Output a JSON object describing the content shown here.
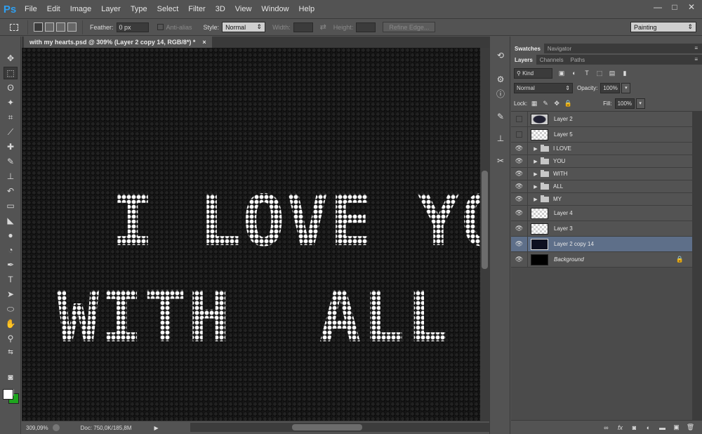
{
  "app": {
    "logo": "Ps"
  },
  "menu": [
    "File",
    "Edit",
    "Image",
    "Layer",
    "Type",
    "Select",
    "Filter",
    "3D",
    "View",
    "Window",
    "Help"
  ],
  "window_controls": {
    "minimize": "—",
    "maximize": "□",
    "close": "✕"
  },
  "options": {
    "feather_label": "Feather:",
    "feather_value": "0 px",
    "antialias_label": "Anti-alias",
    "style_label": "Style:",
    "style_value": "Normal",
    "width_label": "Width:",
    "height_label": "Height:",
    "refine_label": "Refine Edge...",
    "workspace": "Painting"
  },
  "document": {
    "tab_title": "with my hearts.psd @ 309% (Layer 2 copy 14, RGB/8*) *",
    "close": "×",
    "line1": "I LOVE YO",
    "line2": "WITH  ALL"
  },
  "status": {
    "zoom": "309,09%",
    "doc": "Doc: 750,0K/185,8M"
  },
  "panels": {
    "top_tabs": [
      "Swatches",
      "Navigator"
    ],
    "layer_tabs": [
      "Layers",
      "Channels",
      "Paths"
    ],
    "kind_label": "Kind",
    "blend_mode": "Normal",
    "opacity_label": "Opacity:",
    "opacity_value": "100%",
    "lock_label": "Lock:",
    "fill_label": "Fill:",
    "fill_value": "100%"
  },
  "layers": [
    {
      "name": "Layer 2",
      "type": "layer",
      "visible": false,
      "thumb": "blob"
    },
    {
      "name": "Layer 5",
      "type": "layer",
      "visible": false,
      "thumb": "trans"
    },
    {
      "name": "I LOVE",
      "type": "group",
      "visible": true
    },
    {
      "name": "YOU",
      "type": "group",
      "visible": true
    },
    {
      "name": "WITH",
      "type": "group",
      "visible": true
    },
    {
      "name": "ALL",
      "type": "group",
      "visible": true
    },
    {
      "name": "MY",
      "type": "group",
      "visible": true
    },
    {
      "name": "Layer 4",
      "type": "layer",
      "visible": true,
      "thumb": "trans"
    },
    {
      "name": "Layer 3",
      "type": "layer",
      "visible": true,
      "thumb": "trans"
    },
    {
      "name": "Layer 2 copy 14",
      "type": "layer",
      "visible": true,
      "thumb": "navy",
      "selected": true
    },
    {
      "name": "Background",
      "type": "background",
      "visible": true,
      "thumb": "black",
      "locked": true
    }
  ],
  "colors": {
    "foreground": "#ffffff",
    "background": "#1ea51e",
    "selection": "#5e6f89",
    "ui": "#535353"
  }
}
